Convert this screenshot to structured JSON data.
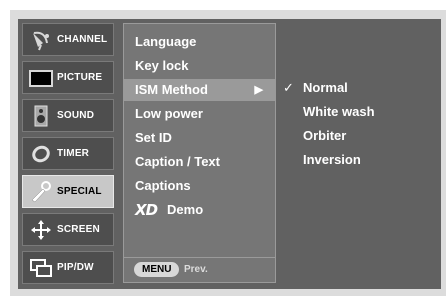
{
  "categories": [
    {
      "label": "CHANNEL",
      "icon": "satellite-dish-icon"
    },
    {
      "label": "PICTURE",
      "icon": "monitor-icon"
    },
    {
      "label": "SOUND",
      "icon": "speaker-icon"
    },
    {
      "label": "TIMER",
      "icon": "clock-icon"
    },
    {
      "label": "SPECIAL",
      "icon": "key-icon",
      "active": true
    },
    {
      "label": "SCREEN",
      "icon": "move-arrows-icon"
    },
    {
      "label": "PIP/DW",
      "icon": "pip-windows-icon"
    }
  ],
  "menu": {
    "items": [
      {
        "label": "Language"
      },
      {
        "label": "Key lock"
      },
      {
        "label": "ISM Method",
        "selected": true,
        "arrow": "▶"
      },
      {
        "label": "Low power"
      },
      {
        "label": "Set ID"
      },
      {
        "label": "Caption / Text"
      },
      {
        "label": "Captions"
      },
      {
        "label": "Demo",
        "logo": "XD"
      }
    ],
    "footer": {
      "button": "MENU",
      "hint": "Prev."
    }
  },
  "submenu": {
    "options": [
      {
        "label": "Normal",
        "checked": true,
        "check": "✓"
      },
      {
        "label": "White wash"
      },
      {
        "label": "Orbiter"
      },
      {
        "label": "Inversion"
      }
    ]
  },
  "colors": {
    "panel": "#616161",
    "menu": "#767676",
    "highlight": "#9a9a9a",
    "active_category": "#c8c8c8"
  }
}
